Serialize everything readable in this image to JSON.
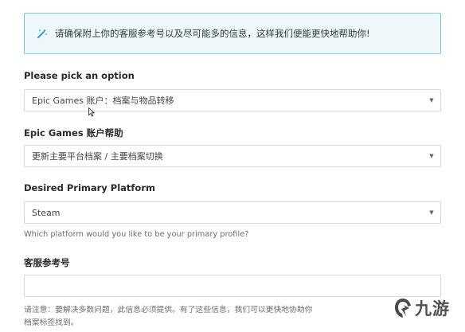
{
  "notice": {
    "icon": "magic-wand-icon",
    "text": "请确保附上你的客服参考号以及尽可能多的信息，这样我们便能更快地帮助你!"
  },
  "form": {
    "option": {
      "label": "Please pick an option",
      "value": "Epic Games 账户：档案与物品转移",
      "icon": "chevron-down-icon"
    },
    "help_topic": {
      "label": "Epic Games 账户帮助",
      "value": "更新主要平台档案 / 主要档案切换",
      "icon": "chevron-down-icon"
    },
    "platform": {
      "label": "Desired Primary Platform",
      "value": "Steam",
      "icon": "chevron-down-icon",
      "help": "Which platform would you like to be your primary profile?"
    },
    "reference": {
      "label": "客服参考号",
      "value": "",
      "help_line1": "请注意：要解决多数问题，此信息必须提供。有了这些信息，我们可以更快地协助你",
      "help_line2": "档案标签找到。"
    }
  },
  "watermark": {
    "text": "九游",
    "icon": "jiuyou-logo"
  },
  "colors": {
    "notice_border": "#7fc6d6",
    "notice_bg": "#eef8fb",
    "field_border": "#d8d8d8"
  }
}
